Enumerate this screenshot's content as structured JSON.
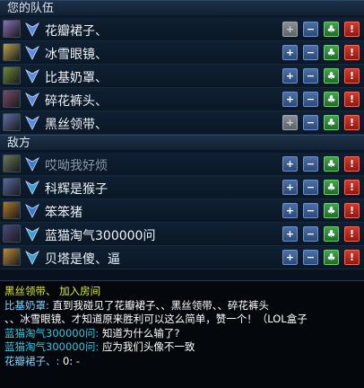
{
  "window": {
    "accent": "#1d3047"
  },
  "sections": {
    "team": "您的队伍",
    "enemy": "敌方"
  },
  "team": [
    {
      "name": "花瓣裙子、",
      "champ_color": "#8a6fb8",
      "rank_color": "#5a8ae0",
      "dim": false,
      "can_add": false
    },
    {
      "name": "冰雪眼镜、",
      "champ_color": "#b7a24e",
      "rank_color": "#5a8ae0",
      "dim": false,
      "can_add": true
    },
    {
      "name": "比基奶罩、",
      "champ_color": "#6c8a3a",
      "rank_color": "#5a8ae0",
      "dim": false,
      "can_add": true
    },
    {
      "name": "碎花裤头、",
      "champ_color": "#7a4a6a",
      "rank_color": "#5a8ae0",
      "dim": false,
      "can_add": true
    },
    {
      "name": "黑丝领带、",
      "champ_color": "#5f6fa8",
      "rank_color": "#5a8ae0",
      "dim": false,
      "can_add": false
    }
  ],
  "enemies": [
    {
      "name": "哎呦我好烦",
      "champ_color": "#6a7a5a",
      "rank_color": "#3a7ad0",
      "dim": true,
      "can_add": true
    },
    {
      "name": "科辉是猴子",
      "champ_color": "#5a6aa0",
      "rank_color": "#3aa0d0",
      "dim": false,
      "can_add": true
    },
    {
      "name": "笨笨猪",
      "champ_color": "#b0782a",
      "rank_color": "#3a7ad0",
      "dim": false,
      "can_add": true
    },
    {
      "name": "蓝猫淘气300000问",
      "champ_color": "#4a4a80",
      "rank_color": "#3aa0d0",
      "dim": false,
      "can_add": true
    },
    {
      "name": "贝塔是傻、逼",
      "champ_color": "#c08a3a",
      "rank_color": "#3aa0d0",
      "dim": false,
      "can_add": true
    }
  ],
  "buttons": {
    "add": "+",
    "minus": "−",
    "like": "♣",
    "report": "!"
  },
  "chat": [
    {
      "who": "黑丝领带、",
      "text": "加入房间",
      "type": "system"
    },
    {
      "who": "比基奶罩:",
      "text": "直到我碰见了花瓣裙子、、黑丝领带、、碎花裤头",
      "type": "team"
    },
    {
      "who": "",
      "text": "、、冰雪眼镜、才知道原来胜利可以这么简单，赞一个！（LOL盒子",
      "type": "cont"
    },
    {
      "who": "蓝猫淘气300000问:",
      "text": "知道为什么输了?",
      "type": "enemy"
    },
    {
      "who": "蓝猫淘气300000问:",
      "text": "应为我们头像不一致",
      "type": "enemy"
    },
    {
      "who": "花瓣裙子、:",
      "text": "0: -",
      "type": "team"
    }
  ]
}
